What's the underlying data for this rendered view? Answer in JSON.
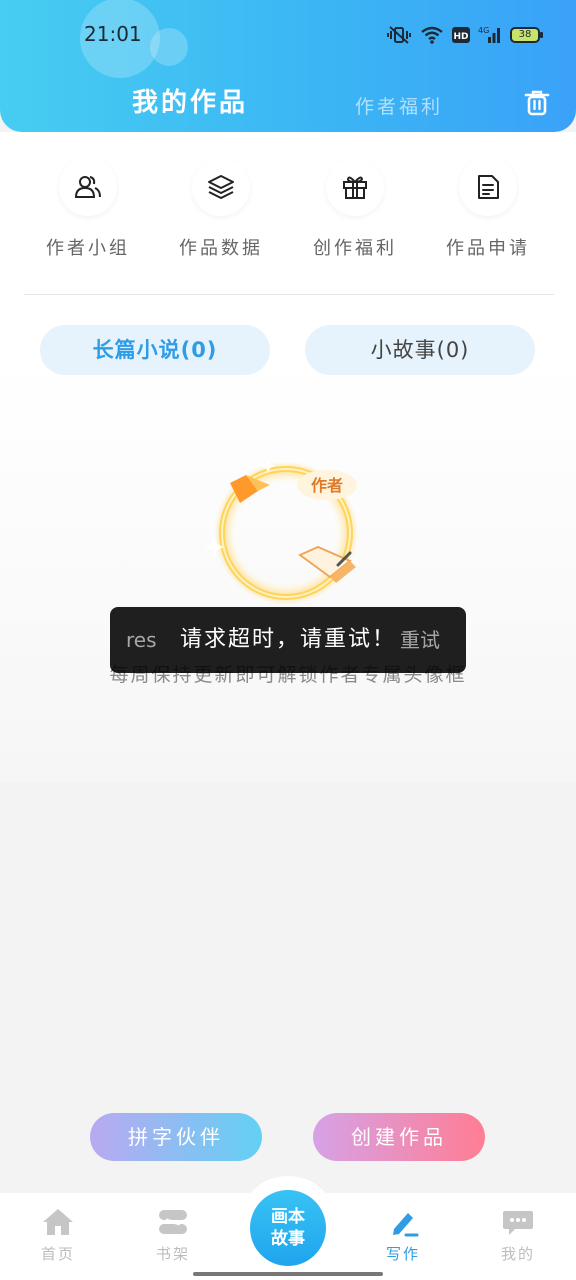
{
  "status_bar": {
    "time": "21:01",
    "battery": "38"
  },
  "header": {
    "tab_active": "我的作品",
    "tab_inactive": "作者福利"
  },
  "shortcuts": [
    {
      "label": "作者小组",
      "icon": "users-icon"
    },
    {
      "label": "作品数据",
      "icon": "layers-icon"
    },
    {
      "label": "创作福利",
      "icon": "gift-icon"
    },
    {
      "label": "作品申请",
      "icon": "document-icon"
    }
  ],
  "segments": {
    "novel": "长篇小说(0)",
    "story": "小故事(0)"
  },
  "empty_state": {
    "badge": "作者",
    "tagline": "每周保持更新即可解锁作者专属头像框"
  },
  "toast": {
    "message": "请求超时，请重试！",
    "ghost_left": "res",
    "ghost_right": "重试"
  },
  "actions": {
    "partner": "拼字伙伴",
    "create": "创建作品"
  },
  "nav": {
    "home": "首页",
    "shelf": "书架",
    "center_line1": "画本",
    "center_line2": "故事",
    "write": "写作",
    "mine": "我的"
  },
  "colors": {
    "accent": "#2f9de6",
    "header_gradient_start": "#47cdf2",
    "header_gradient_end": "#3aa2f8"
  }
}
